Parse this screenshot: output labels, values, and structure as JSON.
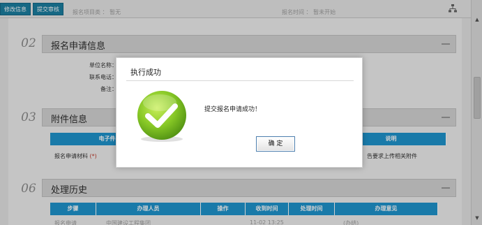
{
  "toolbar": {
    "edit_info": "修改信息",
    "submit_review": "提交审核",
    "info_left": "报名项目类  ：  暂无",
    "info_right": "报名时间  ：  暂未开始"
  },
  "sections": {
    "apply": {
      "num": "02",
      "title": "报名申请信息",
      "labels": [
        "单位名称：",
        "联系电话：",
        "备注："
      ]
    },
    "attachments": {
      "num": "03",
      "title": "附件信息",
      "columns": [
        "电子件名称",
        "说明"
      ],
      "row": {
        "name": "报名申请材料",
        "required_mark": "(*)",
        "note": "告要求上传相关附件"
      }
    },
    "history": {
      "num": "06",
      "title": "处理历史",
      "columns": [
        "步骤",
        "办理人员",
        "操作",
        "收到时间",
        "处理时间",
        "办理意见"
      ],
      "row_partial": {
        "step": "报名申请",
        "person": "中国建设工程集团",
        "received": "11-02 13:25",
        "opinion": "(办结)"
      }
    }
  },
  "modal": {
    "title": "执行成功",
    "message": "提交报名申请成功！",
    "ok_label": "确 定"
  },
  "colors": {
    "table_header": "#1f95cf",
    "button": "#1c7fa2",
    "success_green": "#7cc021"
  }
}
